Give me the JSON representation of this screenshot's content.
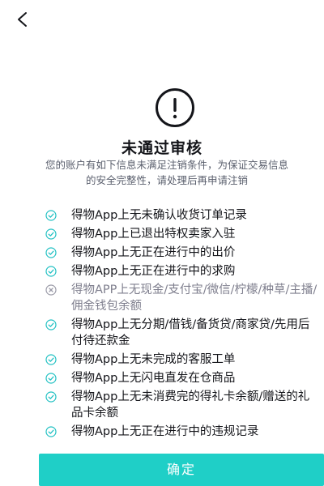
{
  "header": {
    "back_icon": "chevron-left-icon"
  },
  "status": {
    "icon": "exclamation-circle-icon",
    "title": "未通过审核",
    "description_line1": "您的账户有如下信息未满足注销条件，为保证交易信息",
    "description_line2": "的安全完整性，请处理后再申请注销"
  },
  "colors": {
    "accent": "#1fcfc7",
    "check": "#22c1c3",
    "fail": "#9a9aa7"
  },
  "checklist": [
    {
      "status": "pass",
      "icon": "check-circle-icon",
      "text": "得物App上无未确认收货订单记录"
    },
    {
      "status": "pass",
      "icon": "check-circle-icon",
      "text": "得物App上已退出特权卖家入驻"
    },
    {
      "status": "pass",
      "icon": "check-circle-icon",
      "text": "得物App上无正在进行中的出价"
    },
    {
      "status": "pass",
      "icon": "check-circle-icon",
      "text": "得物App上无正在进行中的求购"
    },
    {
      "status": "fail",
      "icon": "x-circle-icon",
      "text": "得物APP上无现金/支付宝/微信/柠檬/种草/主播/佣金钱包余额"
    },
    {
      "status": "pass",
      "icon": "check-circle-icon",
      "text": "得物App上无分期/借钱/备货贷/商家贷/先用后付待还款金"
    },
    {
      "status": "pass",
      "icon": "check-circle-icon",
      "text": "得物App上无未完成的客服工单"
    },
    {
      "status": "pass",
      "icon": "check-circle-icon",
      "text": "得物App上无闪电直发在仓商品"
    },
    {
      "status": "pass",
      "icon": "check-circle-icon",
      "text": "得物App上无未消费完的得礼卡余额/赠送的礼品卡余额"
    },
    {
      "status": "pass",
      "icon": "check-circle-icon",
      "text": "得物App上无正在进行中的违规记录"
    }
  ],
  "footer": {
    "confirm_label": "确定"
  }
}
